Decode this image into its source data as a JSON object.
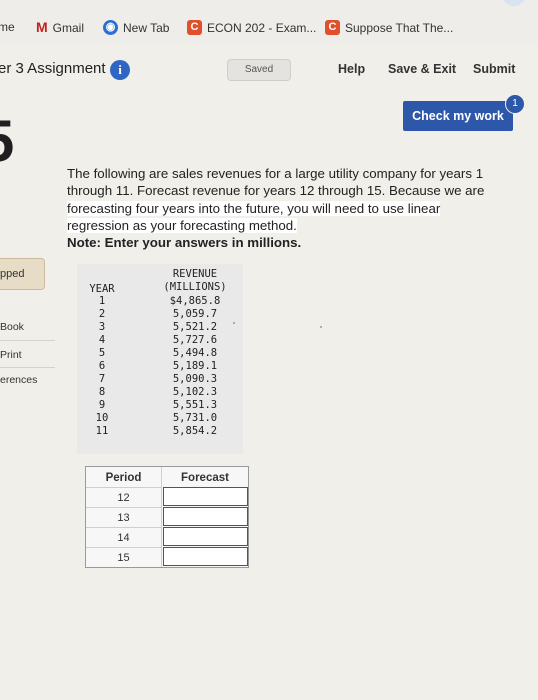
{
  "bookmarks": [
    {
      "label": "me",
      "icon": "none"
    },
    {
      "label": "Gmail",
      "icon": "gmail-icon"
    },
    {
      "label": "New Tab",
      "icon": "new-tab-icon"
    },
    {
      "label": "ECON 202 - Exam...",
      "icon": "c-icon"
    },
    {
      "label": "Suppose That The...",
      "icon": "c-icon"
    }
  ],
  "header": {
    "title": "er 3 Assignment",
    "saved": "Saved",
    "help": "Help",
    "save_exit": "Save & Exit",
    "submit": "Submit"
  },
  "check_work": {
    "label": "Check my work",
    "badge": "1"
  },
  "question_number": "5",
  "sidebar": {
    "skipped": "pped",
    "book": "Book",
    "print": "Print",
    "references": "erences"
  },
  "question": {
    "text": "The following are sales revenues for a large utility company for years 1 through 11. Forecast revenue for years 12 through 15. Forecast four years into the future, you will need to use linear regression as your forecasting method.",
    "line1": "The following are sales revenues for a large utility company for years 1",
    "line2": "through 11. Forecast revenue for years 12 through 15. Because we are",
    "line3": "forecasting four years into the future, you will need to use linear",
    "line4": "regression as your forecasting method.",
    "note": "Note: Enter your answers in millions."
  },
  "data_table": {
    "col_year": "YEAR",
    "col_revenue_1": "REVENUE",
    "col_revenue_2": "(MILLIONS)",
    "rows": [
      {
        "year": "1",
        "revenue": "$4,865.8"
      },
      {
        "year": "2",
        "revenue": "5,059.7"
      },
      {
        "year": "3",
        "revenue": "5,521.2"
      },
      {
        "year": "4",
        "revenue": "5,727.6"
      },
      {
        "year": "5",
        "revenue": "5,494.8"
      },
      {
        "year": "6",
        "revenue": "5,189.1"
      },
      {
        "year": "7",
        "revenue": "5,090.3"
      },
      {
        "year": "8",
        "revenue": "5,102.3"
      },
      {
        "year": "9",
        "revenue": "5,551.3"
      },
      {
        "year": "10",
        "revenue": "5,731.0"
      },
      {
        "year": "11",
        "revenue": "5,854.2"
      }
    ]
  },
  "forecast_table": {
    "col_period": "Period",
    "col_forecast": "Forecast",
    "rows": [
      {
        "period": "12",
        "value": ""
      },
      {
        "period": "13",
        "value": ""
      },
      {
        "period": "14",
        "value": ""
      },
      {
        "period": "15",
        "value": ""
      }
    ]
  }
}
